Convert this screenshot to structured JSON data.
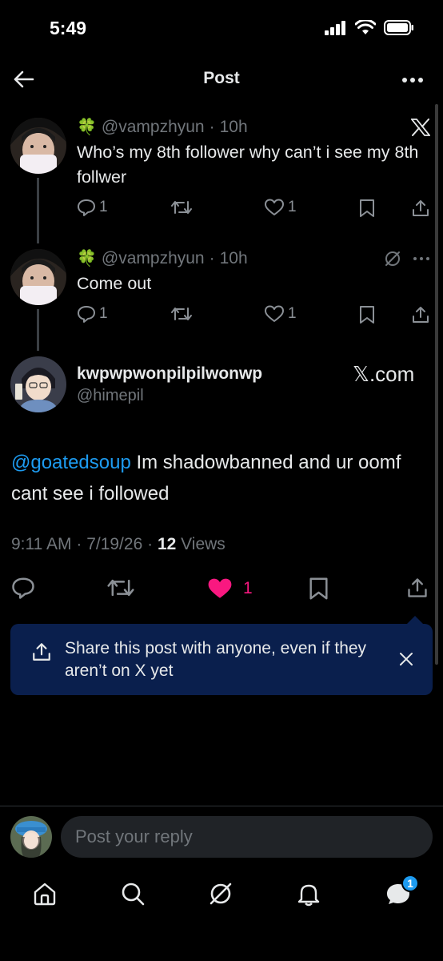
{
  "status_bar": {
    "time": "5:49"
  },
  "header": {
    "title": "Post"
  },
  "thread": [
    {
      "emoji": "🍀",
      "handle": "@vampzhyun",
      "separator": "·",
      "time": "10h",
      "text": "Who’s my 8th follower why can’t i see my 8th follwer",
      "replies": "1",
      "likes": "1",
      "icon": "x-logo-icon"
    },
    {
      "emoji": "🍀",
      "handle": "@vampzhyun",
      "separator": "·",
      "time": "10h",
      "text": "Come out",
      "replies": "1",
      "likes": "1"
    }
  ],
  "main_post": {
    "display_name": "kwpwpwonpilpilwonwp",
    "handle": "@himepil",
    "badge_text": "𝕏.com",
    "mention": "@goatedsoup",
    "text": " Im shadowbanned and ur oomf cant see i followed",
    "time": "9:11 AM",
    "date": "7/19/26",
    "dot": "·",
    "views_count": "12",
    "views_label": "Views",
    "likes": "1"
  },
  "share_banner": {
    "text": "Share this post with anyone, even if they aren’t on X yet"
  },
  "reply": {
    "placeholder": "Post your reply"
  },
  "nav": {
    "messages_badge": "1"
  },
  "colors": {
    "accent": "#1d9bf0",
    "like": "#f91880",
    "banner_bg": "#0a1f4d"
  }
}
